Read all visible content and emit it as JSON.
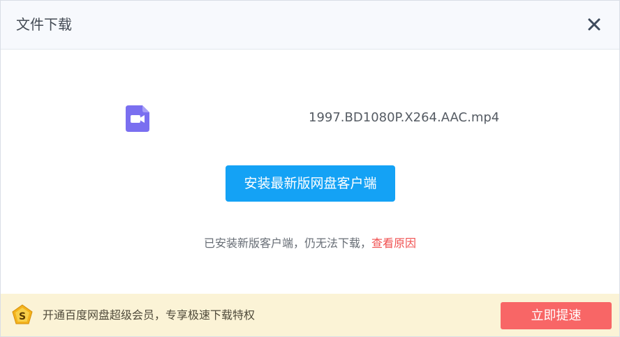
{
  "dialog": {
    "title": "文件下载",
    "close_icon": "close-icon"
  },
  "file": {
    "icon": "video-file-icon",
    "icon_color": "#7a6ff0",
    "name": "1997.BD1080P.X264.AAC.mp4"
  },
  "install": {
    "label": "安装最新版网盘客户端",
    "color": "#14a2f5"
  },
  "notice": {
    "text": "已安装新版客户端，仍无法下载，",
    "link_text": "查看原因",
    "link_color": "#f05050"
  },
  "footer": {
    "vip_icon": "vip-diamond-icon",
    "promo_text": "开通百度网盘超级会员，专享极速下载特权",
    "upgrade_label": "立即提速",
    "upgrade_color": "#f86666",
    "background": "#fbf3d6"
  }
}
